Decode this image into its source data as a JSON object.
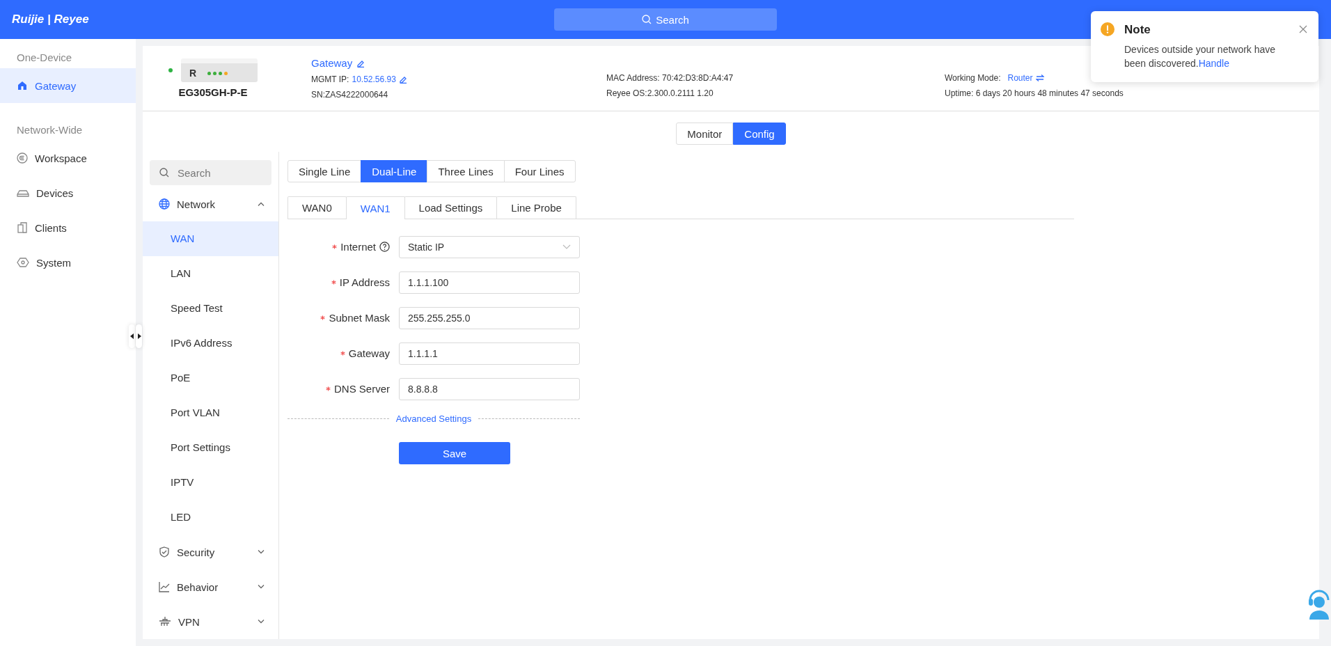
{
  "header": {
    "logo": "Ruijie | Reyee",
    "search_label": "Search"
  },
  "sidebar": {
    "sections": [
      {
        "title": "One-Device",
        "items": [
          {
            "label": "Gateway",
            "selected": true
          }
        ]
      },
      {
        "title": "Network-Wide",
        "items": [
          {
            "label": "Workspace",
            "selected": false
          },
          {
            "label": "Devices",
            "selected": false
          },
          {
            "label": "Clients",
            "selected": false
          },
          {
            "label": "System",
            "selected": false
          }
        ]
      }
    ]
  },
  "device": {
    "online": true,
    "model": "EG305GH-P-E",
    "badge": "R",
    "name": "Gateway",
    "mgmt_ip_label": "MGMT IP:",
    "mgmt_ip": "10.52.56.93",
    "sn": "SN:ZAS4222000644",
    "mac": "MAC Address: 70:42:D3:8D:A4:47",
    "os": "Reyee OS:2.300.0.2111 1.20",
    "working_mode_label": "Working Mode:",
    "working_mode": "Router",
    "uptime": "Uptime: 6 days 20 hours 48 minutes 47 seconds"
  },
  "view_toggle": [
    {
      "label": "Monitor",
      "selected": false
    },
    {
      "label": "Config",
      "selected": true
    }
  ],
  "menu": {
    "search_placeholder": "Search",
    "groups": [
      {
        "label": "Network",
        "expanded": true,
        "children": [
          {
            "label": "WAN",
            "selected": true
          },
          {
            "label": "LAN",
            "selected": false
          },
          {
            "label": "Speed Test",
            "selected": false
          },
          {
            "label": "IPv6 Address",
            "selected": false
          },
          {
            "label": "PoE",
            "selected": false
          },
          {
            "label": "Port VLAN",
            "selected": false
          },
          {
            "label": "Port Settings",
            "selected": false
          },
          {
            "label": "IPTV",
            "selected": false
          },
          {
            "label": "LED",
            "selected": false
          }
        ]
      },
      {
        "label": "Security",
        "expanded": false
      },
      {
        "label": "Behavior",
        "expanded": false
      },
      {
        "label": "VPN",
        "expanded": false
      }
    ]
  },
  "line_tabs": [
    {
      "label": "Single Line",
      "selected": false
    },
    {
      "label": "Dual-Line",
      "selected": true
    },
    {
      "label": "Three Lines",
      "selected": false
    },
    {
      "label": "Four Lines",
      "selected": false
    }
  ],
  "wan_tabs": [
    {
      "label": "WAN0",
      "selected": false
    },
    {
      "label": "WAN1",
      "selected": true
    },
    {
      "label": "Load Settings",
      "selected": false
    },
    {
      "label": "Line Probe",
      "selected": false
    }
  ],
  "form": {
    "fields": [
      {
        "kind": "select",
        "label": "Internet",
        "required": true,
        "help": true,
        "value": "Static IP"
      },
      {
        "kind": "input",
        "label": "IP Address",
        "required": true,
        "help": false,
        "value": "1.1.1.100"
      },
      {
        "kind": "input",
        "label": "Subnet Mask",
        "required": true,
        "help": false,
        "value": "255.255.255.0"
      },
      {
        "kind": "input",
        "label": "Gateway",
        "required": true,
        "help": false,
        "value": "1.1.1.1"
      },
      {
        "kind": "input",
        "label": "DNS Server",
        "required": true,
        "help": false,
        "value": "8.8.8.8"
      }
    ],
    "advanced_link": "Advanced Settings",
    "save_button": "Save"
  },
  "note": {
    "title": "Note",
    "message": "Devices outside your network have been discovered.",
    "link": "Handle"
  }
}
